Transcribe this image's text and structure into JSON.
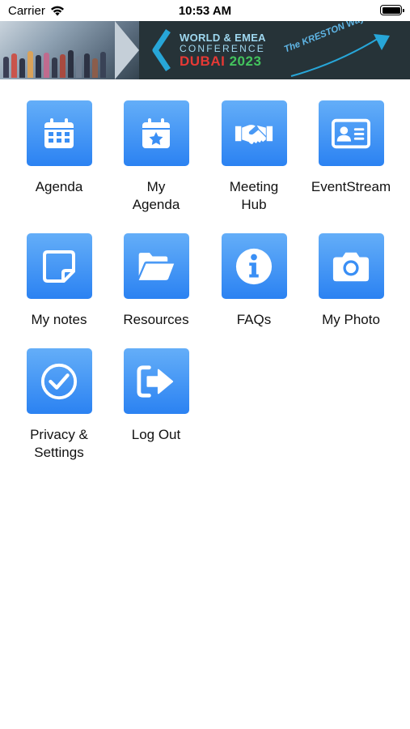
{
  "status_bar": {
    "carrier": "Carrier",
    "time": "10:53 AM",
    "wifi_icon": "wifi-icon",
    "battery_icon": "battery-full-icon"
  },
  "banner": {
    "line1": "WORLD & EMEA",
    "line2": "CONFERENCE",
    "city": "DUBAI",
    "year": "2023",
    "tagline": "The KRESTON Way",
    "colors": {
      "background": "#263338",
      "accent": "#9fd8f0",
      "city": "#e53935",
      "year": "#43c35d",
      "tagline": "#5fb6e6"
    }
  },
  "menu": {
    "tile_color": "#3a8ff5",
    "items": [
      {
        "label": "Agenda",
        "icon": "calendar-icon"
      },
      {
        "label": "My\nAgenda",
        "icon": "calendar-star-icon"
      },
      {
        "label": "Meeting\nHub",
        "icon": "handshake-icon"
      },
      {
        "label": "EventStream",
        "icon": "id-card-icon"
      },
      {
        "label": "My notes",
        "icon": "sticky-note-icon"
      },
      {
        "label": "Resources",
        "icon": "folder-open-icon"
      },
      {
        "label": "FAQs",
        "icon": "info-icon"
      },
      {
        "label": "My Photo",
        "icon": "camera-icon"
      },
      {
        "label": "Privacy &\nSettings",
        "icon": "check-circle-icon"
      },
      {
        "label": "Log Out",
        "icon": "sign-out-icon"
      }
    ]
  }
}
